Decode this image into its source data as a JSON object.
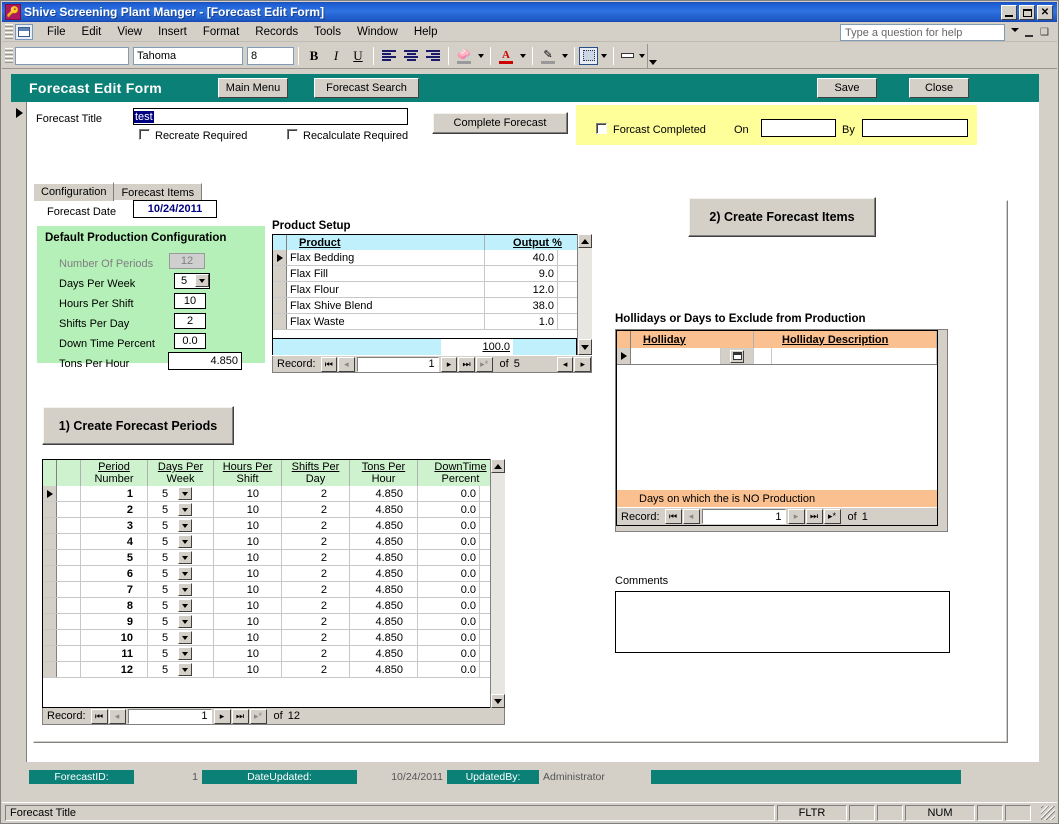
{
  "window": {
    "title": "Shive Screening Plant Manger - [Forecast Edit Form]",
    "minimize": "_",
    "maximize": "□",
    "close": "✕"
  },
  "menubar": {
    "items": [
      "File",
      "Edit",
      "View",
      "Insert",
      "Format",
      "Records",
      "Tools",
      "Window",
      "Help"
    ],
    "help_placeholder": "Type a question for help"
  },
  "formatbar": {
    "style_value": "",
    "font_value": "Tahoma",
    "size_value": "8",
    "bold": "B",
    "italic": "I",
    "underline": "U"
  },
  "form": {
    "header": {
      "title": "Forecast Edit Form",
      "main_menu": "Main Menu",
      "forecast_search": "Forecast Search",
      "save": "Save",
      "close": "Close"
    },
    "title_label": "Forecast Title",
    "title_value": "test",
    "recreate_required": "Recreate Required",
    "recalculate_required": "Recalculate Required",
    "complete_forecast": "Complete Forecast",
    "forcast_completed": "Forcast Completed",
    "on_label": "On",
    "on_value": "",
    "by_label": "By",
    "by_value": "",
    "tabs": [
      {
        "label": "Configuration",
        "active": true
      },
      {
        "label": "Forecast Items",
        "active": false
      }
    ],
    "forecast_date_label": "Forecast Date",
    "forecast_date_value": "10/24/2011"
  },
  "default_config": {
    "title": "Default Production Configuration",
    "rows": [
      {
        "label": "Number Of Periods",
        "value": "12",
        "disabled": true,
        "dropdown": false
      },
      {
        "label": "Days Per Week",
        "value": "5",
        "disabled": false,
        "dropdown": true
      },
      {
        "label": "Hours Per Shift",
        "value": "10",
        "disabled": false,
        "dropdown": false
      },
      {
        "label": "Shifts Per Day",
        "value": "2",
        "disabled": false,
        "dropdown": false
      },
      {
        "label": "Down Time Percent",
        "value": "0.0",
        "disabled": false,
        "dropdown": false
      },
      {
        "label": "Tons Per Hour",
        "value": "4.850",
        "disabled": false,
        "dropdown": false
      }
    ]
  },
  "product_setup": {
    "title": "Product Setup",
    "columns": [
      "Product",
      "Output %"
    ],
    "rows": [
      {
        "product": "Flax Bedding",
        "output": "40.0",
        "current": true
      },
      {
        "product": "Flax Fill",
        "output": "9.0",
        "current": false
      },
      {
        "product": "Flax Flour",
        "output": "12.0",
        "current": false
      },
      {
        "product": "Flax Shive Blend",
        "output": "38.0",
        "current": false
      },
      {
        "product": "Flax Waste",
        "output": "1.0",
        "current": false
      }
    ],
    "total": "100.0",
    "nav": {
      "label": "Record:",
      "current": "1",
      "of_label": "of",
      "total": "5"
    }
  },
  "create_periods_button": "1) Create Forecast Periods",
  "create_items_button": "2) Create Forecast Items",
  "periods": {
    "columns": [
      {
        "line1": "Period",
        "line2": "Number"
      },
      {
        "line1": "Days Per",
        "line2": "Week"
      },
      {
        "line1": "Hours Per",
        "line2": "Shift"
      },
      {
        "line1": "Shifts Per",
        "line2": "Day"
      },
      {
        "line1": "Tons Per",
        "line2": "Hour"
      },
      {
        "line1": "DownTime",
        "line2": "Percent"
      }
    ],
    "rows": [
      {
        "number": "1",
        "days": "5",
        "hours": "10",
        "shifts": "2",
        "tons": "4.850",
        "downtime": "0.0",
        "current": true
      },
      {
        "number": "2",
        "days": "5",
        "hours": "10",
        "shifts": "2",
        "tons": "4.850",
        "downtime": "0.0",
        "current": false
      },
      {
        "number": "3",
        "days": "5",
        "hours": "10",
        "shifts": "2",
        "tons": "4.850",
        "downtime": "0.0",
        "current": false
      },
      {
        "number": "4",
        "days": "5",
        "hours": "10",
        "shifts": "2",
        "tons": "4.850",
        "downtime": "0.0",
        "current": false
      },
      {
        "number": "5",
        "days": "5",
        "hours": "10",
        "shifts": "2",
        "tons": "4.850",
        "downtime": "0.0",
        "current": false
      },
      {
        "number": "6",
        "days": "5",
        "hours": "10",
        "shifts": "2",
        "tons": "4.850",
        "downtime": "0.0",
        "current": false
      },
      {
        "number": "7",
        "days": "5",
        "hours": "10",
        "shifts": "2",
        "tons": "4.850",
        "downtime": "0.0",
        "current": false
      },
      {
        "number": "8",
        "days": "5",
        "hours": "10",
        "shifts": "2",
        "tons": "4.850",
        "downtime": "0.0",
        "current": false
      },
      {
        "number": "9",
        "days": "5",
        "hours": "10",
        "shifts": "2",
        "tons": "4.850",
        "downtime": "0.0",
        "current": false
      },
      {
        "number": "10",
        "days": "5",
        "hours": "10",
        "shifts": "2",
        "tons": "4.850",
        "downtime": "0.0",
        "current": false
      },
      {
        "number": "11",
        "days": "5",
        "hours": "10",
        "shifts": "2",
        "tons": "4.850",
        "downtime": "0.0",
        "current": false
      },
      {
        "number": "12",
        "days": "5",
        "hours": "10",
        "shifts": "2",
        "tons": "4.850",
        "downtime": "0.0",
        "current": false
      }
    ],
    "nav": {
      "label": "Record:",
      "current": "1",
      "of_label": "of",
      "total": "12"
    }
  },
  "hollidays": {
    "title": "Hollidays or Days to Exclude from Production",
    "columns": [
      "Holliday",
      "Holliday Description"
    ],
    "rows": [
      {
        "holliday": "",
        "description": "",
        "current": true
      }
    ],
    "footer_note": "Days on which the is NO Production",
    "nav": {
      "label": "Record:",
      "current": "1",
      "of_label": "of",
      "total": "1"
    }
  },
  "comments": {
    "label": "Comments",
    "value": ""
  },
  "form_footer": {
    "forecast_id_label": "ForecastID:",
    "forecast_id_value": "1",
    "date_updated_label": "DateUpdated:",
    "date_updated_value": "10/24/2011",
    "updated_by_label": "UpdatedBy:",
    "updated_by_value": "Administrator"
  },
  "statusbar": {
    "message": "Forecast Title",
    "filter": "FLTR",
    "num": "NUM"
  },
  "colors": {
    "teal": "#0b8077",
    "green_panel": "#b5f0b8",
    "yellow_panel": "#ffff99",
    "orange_header": "#fac090",
    "cyan_header": "#bff0fb",
    "chrome": "#d4d0c8"
  }
}
